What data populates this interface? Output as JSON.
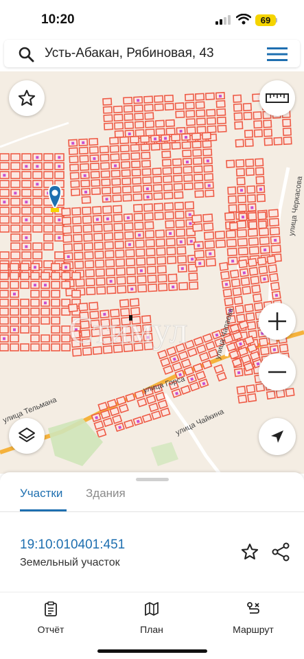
{
  "status_bar": {
    "time": "10:20",
    "battery": "69"
  },
  "search": {
    "query": "Усть-Абакан, Рябиновая, 43"
  },
  "map": {
    "watermark": "Стимул",
    "street_labels": [
      "улица Горса",
      "улица Черкасова",
      "улица Тельмана",
      "улица Чапаева",
      "улица Чайкина"
    ]
  },
  "sheet": {
    "tabs": [
      {
        "label": "Участки",
        "active": true
      },
      {
        "label": "Здания",
        "active": false
      }
    ],
    "parcel": {
      "cadastral_number": "19:10:010401:451",
      "type": "Земельный участок"
    }
  },
  "bottom_nav": [
    {
      "label": "Отчёт",
      "icon": "report-icon"
    },
    {
      "label": "План",
      "icon": "map-icon"
    },
    {
      "label": "Маршрут",
      "icon": "route-icon"
    }
  ],
  "colors": {
    "accent": "#1e6fb0",
    "parcel": "#ee5a45",
    "road": "#f5b23c",
    "battery": "#f5d400"
  }
}
